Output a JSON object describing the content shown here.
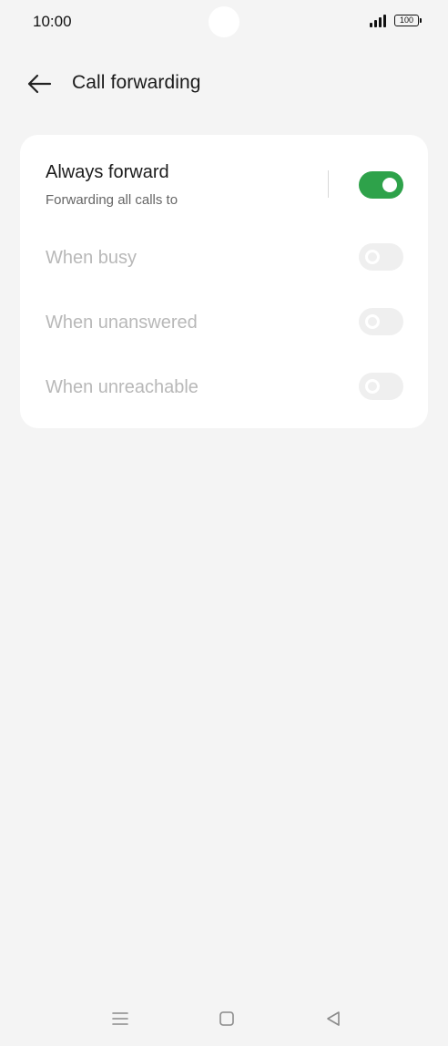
{
  "status_bar": {
    "time": "10:00",
    "battery": "100",
    "icons": [
      "signal-icon",
      "battery-icon"
    ]
  },
  "header": {
    "title": "Call forwarding",
    "back_icon": "arrow-left-icon"
  },
  "forwarding_options": [
    {
      "label": "Always forward",
      "subtitle": "Forwarding all calls to",
      "enabled": true,
      "checked": true
    },
    {
      "label": "When busy",
      "enabled": false,
      "checked": false
    },
    {
      "label": "When unanswered",
      "enabled": false,
      "checked": false
    },
    {
      "label": "When unreachable",
      "enabled": false,
      "checked": false
    }
  ],
  "nav_bar": {
    "icons": [
      "menu-icon",
      "home-icon",
      "back-icon"
    ]
  },
  "colors": {
    "background": "#f4f4f4",
    "card": "#ffffff",
    "toggle_on": "#2ea24a",
    "toggle_off": "#efefef",
    "disabled_text": "#b8b8b8"
  }
}
